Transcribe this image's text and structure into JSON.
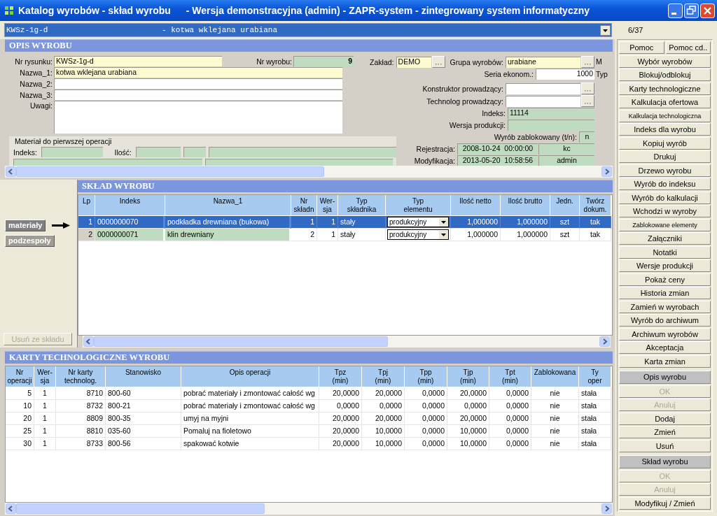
{
  "window": {
    "title": "Katalog wyrobów - skład wyrobu",
    "subtitle": "- Wersja demonstracyjna (admin) - ZAPR-system - zintegrowany system informatyczny"
  },
  "product_selector": {
    "code": "KWSz-1g-d",
    "name": "- kotwa wklejana urabiana"
  },
  "record_counter": "6/37",
  "opis": {
    "title": "OPIS WYROBU",
    "drawing_no": {
      "label": "Nr rysunku:",
      "value": "KWSz-1g-d"
    },
    "product_no": {
      "label": "Nr wyrobu:",
      "value": "9"
    },
    "names": [
      {
        "label": "Nazwa_1:",
        "value": "kotwa wklejana urabiana"
      },
      {
        "label": "Nazwa_2:"
      },
      {
        "label": "Nazwa_3:"
      }
    ],
    "notes": {
      "label": "Uwagi:"
    },
    "material_group": {
      "title": "Materiał do pierwszej operacji",
      "index_label": "Indeks:",
      "qty_label": "Ilość:"
    },
    "plant": {
      "label": "Zakład:",
      "value": "DEMO"
    },
    "product_group": {
      "label": "Grupa wyrobów:",
      "value": "urabiane"
    },
    "batch": {
      "label": "Seria ekonom.:",
      "value": "1000"
    },
    "designer": {
      "label": "Konstruktor prowadzący:"
    },
    "technologist": {
      "label": "Technolog prowadzący:"
    },
    "index": {
      "label": "Indeks:",
      "value": "11114"
    },
    "prod_version": {
      "label": "Wersja produkcji:"
    },
    "blocked": {
      "label": "Wyrób zablokowany (t/n):",
      "value": "n"
    },
    "registration": {
      "label": "Rejestracja:",
      "date": "2008-10-24  00:00:00",
      "user": "kc"
    },
    "modification": {
      "label": "Modyfikacja:",
      "date": "2013-05-20  10:58:56",
      "user": "admin"
    },
    "edge_labels": [
      "M",
      "Typ"
    ]
  },
  "side_panel": {
    "buttons": [
      {
        "label": "materiały",
        "selected": true
      },
      {
        "label": "podzespoły",
        "selected": false
      }
    ],
    "remove_button": {
      "label": "Usuń ze składu",
      "disabled": true
    }
  },
  "sklad": {
    "title": "SKŁAD WYROBU",
    "columns": [
      "Lp",
      "Indeks",
      "Nazwa_1",
      "Nr\nskładn",
      "Wer-\nsja",
      "Typ\nskładnika",
      "Typ\nelementu",
      "Ilość netto",
      "Ilość brutto",
      "Jedn.",
      "Twórz\ndokum."
    ],
    "rows": [
      {
        "selected": true,
        "cells": [
          "1",
          "0000000070",
          "podkładka drewniana (bukowa)",
          "1",
          "1",
          "stały",
          "produkcyjny",
          "1,000000",
          "1,000000",
          "szt",
          "tak"
        ]
      },
      {
        "selected": false,
        "cells": [
          "2",
          "0000000071",
          "klin drewniany",
          "2",
          "1",
          "stały",
          "produkcyjny",
          "1,000000",
          "1,000000",
          "szt",
          "tak"
        ]
      }
    ]
  },
  "karty": {
    "title": "KARTY TECHNOLOGICZNE WYROBU",
    "columns": [
      "Nr\noperacji",
      "Wer-\nsja",
      "Nr karty\ntechnolog.",
      "Stanowisko",
      "Opis operacji",
      "Tpz\n(min)",
      "Tpj\n(min)",
      "Tpp\n(min)",
      "Tjp\n(min)",
      "Tpt\n(min)",
      "Zablokowana",
      "Ty\noper"
    ],
    "rows": [
      [
        "5",
        "1",
        "8710",
        "800-60",
        "pobrać materiały i zmontować całość wg",
        "20,0000",
        "20,0000",
        "0,0000",
        "20,0000",
        "0,0000",
        "nie",
        "stała"
      ],
      [
        "10",
        "1",
        "8732",
        "800-21",
        "pobrać materiały i zmontować całość wg",
        "0,0000",
        "0,0000",
        "0,0000",
        "0,0000",
        "0,0000",
        "nie",
        "stała"
      ],
      [
        "20",
        "1",
        "8809",
        "800-35",
        "umyj na myjni",
        "20,0000",
        "20,0000",
        "0,0000",
        "20,0000",
        "0,0000",
        "nie",
        "stała"
      ],
      [
        "25",
        "1",
        "8810",
        "035-60",
        "Pomaluj na fioletowo",
        "20,0000",
        "10,0000",
        "0,0000",
        "10,0000",
        "0,0000",
        "nie",
        "stała"
      ],
      [
        "30",
        "1",
        "8733",
        "800-56",
        "spakować kotwie",
        "20,0000",
        "10,0000",
        "0,0000",
        "10,0000",
        "0,0000",
        "nie",
        "stała"
      ]
    ]
  },
  "sidebar": [
    {
      "kind": "pair",
      "buttons": [
        {
          "label": "Pomoc",
          "disabled": false
        },
        {
          "label": "Pomoc cd..",
          "disabled": false
        }
      ]
    },
    {
      "kind": "button",
      "label": "Wybór wyrobów",
      "disabled": false
    },
    {
      "kind": "button",
      "label": "Blokuj/odblokuj",
      "disabled": false
    },
    {
      "kind": "button",
      "label": "Karty technologiczne",
      "disabled": false
    },
    {
      "kind": "button",
      "label": "Kalkulacja ofertowa",
      "disabled": false
    },
    {
      "kind": "small",
      "label": "Kalkulacja technologiczna",
      "disabled": false
    },
    {
      "kind": "button",
      "label": "Indeks dla wyrobu",
      "disabled": false
    },
    {
      "kind": "button",
      "label": "Kopiuj wyrób",
      "disabled": false
    },
    {
      "kind": "button",
      "label": "Drukuj",
      "disabled": false
    },
    {
      "kind": "button",
      "label": "Drzewo wyrobu",
      "disabled": false
    },
    {
      "kind": "button",
      "label": "Wyrób do  indeksu",
      "disabled": false
    },
    {
      "kind": "button",
      "label": "Wyrób do kalkulacji",
      "disabled": false
    },
    {
      "kind": "button",
      "label": "Wchodzi w wyroby",
      "disabled": false
    },
    {
      "kind": "small",
      "label": "Zablokowane elementy",
      "disabled": false
    },
    {
      "kind": "button",
      "label": "Załączniki",
      "disabled": false
    },
    {
      "kind": "button",
      "label": "Notatki",
      "disabled": false
    },
    {
      "kind": "button",
      "label": "Wersje produkcji",
      "disabled": false
    },
    {
      "kind": "button",
      "label": "Pokaż ceny",
      "disabled": false
    },
    {
      "kind": "button",
      "label": "Historia zmian",
      "disabled": false
    },
    {
      "kind": "button",
      "label": "Zamień w wyrobach",
      "disabled": false
    },
    {
      "kind": "button",
      "label": "Wyrób do archiwum",
      "disabled": false
    },
    {
      "kind": "button",
      "label": "Archiwum wyrobów",
      "disabled": false
    },
    {
      "kind": "button",
      "label": "Akceptacja",
      "disabled": false
    },
    {
      "kind": "button",
      "label": "Karta zmian",
      "disabled": false
    },
    {
      "kind": "header",
      "label": "Opis wyrobu"
    },
    {
      "kind": "button",
      "label": "OK",
      "disabled": true
    },
    {
      "kind": "button",
      "label": "Anuluj",
      "disabled": true
    },
    {
      "kind": "button",
      "label": "Dodaj",
      "disabled": false
    },
    {
      "kind": "button",
      "label": "Zmień",
      "disabled": false
    },
    {
      "kind": "button",
      "label": "Usuń",
      "disabled": false
    },
    {
      "kind": "header",
      "label": "Skład wyrobu"
    },
    {
      "kind": "button",
      "label": "OK",
      "disabled": true
    },
    {
      "kind": "button",
      "label": "Anuluj",
      "disabled": true
    },
    {
      "kind": "button",
      "label": "Modyfikuj / Zmień",
      "disabled": false
    }
  ]
}
